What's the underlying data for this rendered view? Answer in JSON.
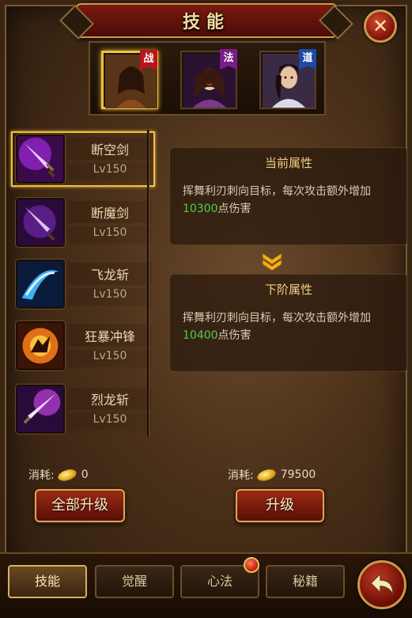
{
  "title": "技能",
  "characters": [
    {
      "tag": "战",
      "tag_color": "#b8141c",
      "selected": true
    },
    {
      "tag": "法",
      "tag_color": "#7a1c8a",
      "selected": false
    },
    {
      "tag": "道",
      "tag_color": "#1c4aa8",
      "selected": false
    }
  ],
  "skills": [
    {
      "name": "断空剑",
      "level": "Lv150",
      "selected": true
    },
    {
      "name": "断魔剑",
      "level": "Lv150",
      "selected": false
    },
    {
      "name": "飞龙斩",
      "level": "Lv150",
      "selected": false
    },
    {
      "name": "狂暴冲锋",
      "level": "Lv150",
      "selected": false
    },
    {
      "name": "烈龙斩",
      "level": "Lv150",
      "selected": false
    }
  ],
  "current_attr": {
    "title": "当前属性",
    "desc_before": "挥舞利刃刺向目标，每次攻击额外增加",
    "value": "10300",
    "desc_after": "点伤害"
  },
  "next_attr": {
    "title": "下阶属性",
    "desc_before": "挥舞利刃刺向目标，每次攻击额外增加",
    "value": "10400",
    "desc_after": "点伤害"
  },
  "cost_all": {
    "label": "消耗:",
    "amount": "0"
  },
  "cost_single": {
    "label": "消耗:",
    "amount": "79500"
  },
  "buttons": {
    "upgrade_all": "全部升级",
    "upgrade": "升级"
  },
  "tabs": [
    {
      "label": "技能",
      "active": true
    },
    {
      "label": "觉醒",
      "active": false
    },
    {
      "label": "心法",
      "active": false,
      "badge": true
    },
    {
      "label": "秘籍",
      "active": false
    }
  ],
  "colors": {
    "highlight_value": "#4ad050",
    "title_gold": "#f0d080",
    "selected_border": "#f0c040"
  }
}
